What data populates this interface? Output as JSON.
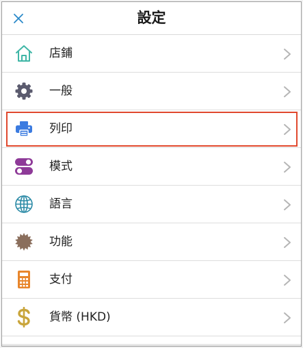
{
  "header": {
    "title": "設定",
    "close_icon": "close-icon"
  },
  "settings": {
    "items": [
      {
        "label": "店鋪",
        "icon": "store-icon",
        "icon_color": "#3fb6a6"
      },
      {
        "label": "一般",
        "icon": "gear-icon",
        "icon_color": "#5b5b6e"
      },
      {
        "label": "列印",
        "icon": "printer-icon",
        "icon_color": "#3b7be0",
        "highlighted": true,
        "highlight_color": "#e0482d"
      },
      {
        "label": "模式",
        "icon": "toggle-icon",
        "icon_color": "#8e3a98"
      },
      {
        "label": "語言",
        "icon": "globe-icon",
        "icon_color": "#2b8aa6"
      },
      {
        "label": "功能",
        "icon": "badge-icon",
        "icon_color": "#8a6e5c"
      },
      {
        "label": "支付",
        "icon": "calculator-icon",
        "icon_color": "#e8862c"
      },
      {
        "label": "貨幣 (HKD)",
        "icon": "dollar-icon",
        "icon_color": "#c9a53b"
      }
    ]
  }
}
